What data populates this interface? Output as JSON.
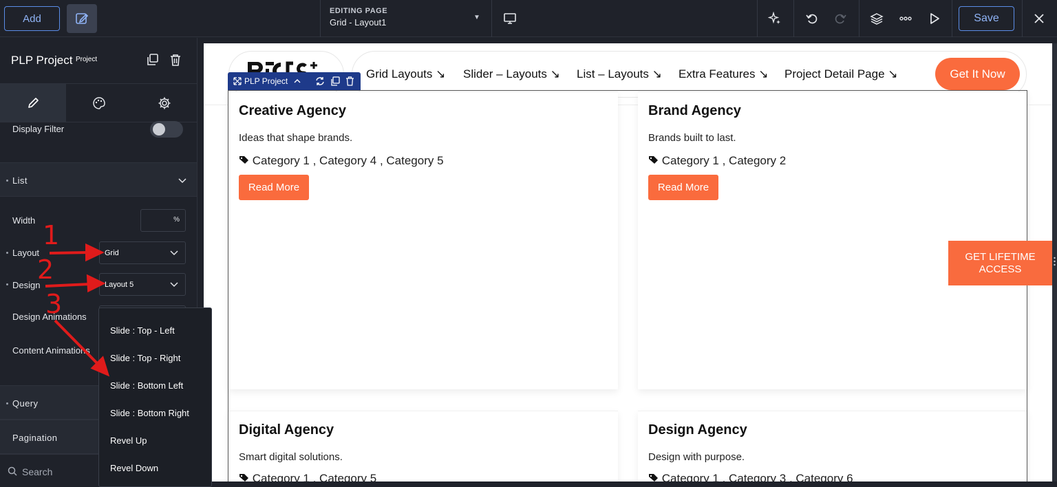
{
  "topbar": {
    "add_label": "Add",
    "editing_label": "EDITING PAGE",
    "editing_value": "Grid - Layout1",
    "save_label": "Save"
  },
  "panel": {
    "title": "PLP Project",
    "badge": "Project",
    "display_filter_label": "Display Filter",
    "list_section": "List",
    "width_label": "Width",
    "width_unit": "%",
    "layout_label": "Layout",
    "layout_value": "Grid",
    "design_label": "Design",
    "design_value": "Layout 5",
    "design_animations_label": "Design Animations",
    "content_animations_label": "Content Animations",
    "query_section": "Query",
    "pagination_section": "Pagination",
    "search_placeholder": "Search"
  },
  "dropdown": {
    "options": [
      "Slide : Top - Left",
      "Slide : Top - Right",
      "Slide : Bottom Left",
      "Slide : Bottom Right",
      "Revel Up",
      "Revel Down"
    ]
  },
  "annotations": [
    "1",
    "2",
    "3"
  ],
  "site": {
    "nav": [
      "Grid Layouts ↘",
      "Slider – Layouts ↘",
      "List – Layouts ↘",
      "Extra Features ↘",
      "Project Detail Page ↘"
    ],
    "cta": "Get It Now",
    "widget_tag": "PLP Project",
    "lifetime_line1": "GET LIFETIME",
    "lifetime_line2": "ACCESS",
    "cards": [
      {
        "title": "Creative Agency",
        "subtitle": "Ideas that shape brands.",
        "categories": "Category 1 , Category 4 , Category 5",
        "button": "Read More"
      },
      {
        "title": "Brand Agency",
        "subtitle": "Brands built to last.",
        "categories": "Category 1 , Category 2",
        "button": "Read More"
      },
      {
        "title": "Digital Agency",
        "subtitle": "Smart digital solutions.",
        "categories": "Category 1 , Category 5"
      },
      {
        "title": "Design Agency",
        "subtitle": "Design with purpose.",
        "categories": "Category 1 , Category 3 , Category 6"
      }
    ]
  },
  "colors": {
    "accent": "#fa6b3d",
    "editor_bg": "#1f222a",
    "editor_blue": "#5b8de8",
    "annotation_red": "#e01b1b"
  }
}
